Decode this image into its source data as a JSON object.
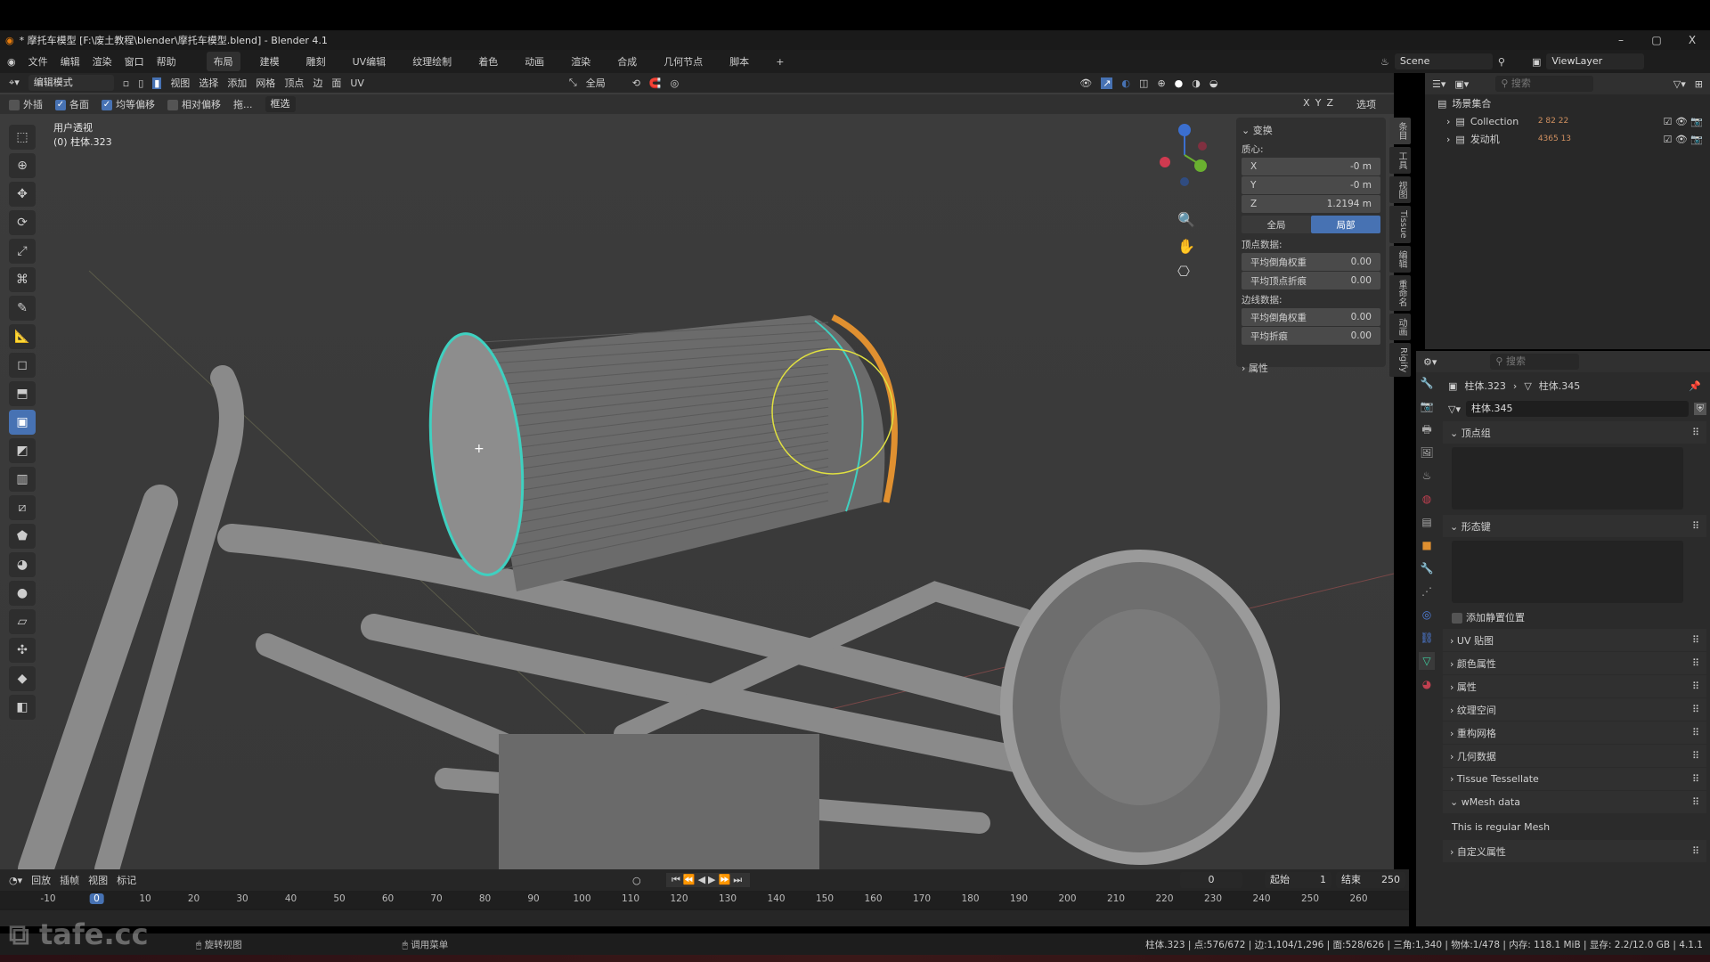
{
  "window": {
    "title": "* 摩托车模型 [F:\\废土教程\\blender\\摩托车模型.blend] - Blender 4.1",
    "minimize": "–",
    "maximize": "▢",
    "close": "X"
  },
  "menu": [
    "文件",
    "编辑",
    "渲染",
    "窗口",
    "帮助"
  ],
  "workspaces": [
    "布局",
    "建模",
    "雕刻",
    "UV编辑",
    "纹理绘制",
    "着色",
    "动画",
    "渲染",
    "合成",
    "几何节点",
    "脚本",
    "+"
  ],
  "scene": {
    "scene_label": "Scene",
    "viewlayer_label": "ViewLayer"
  },
  "viewport_header": {
    "mode": "编辑模式",
    "menus": [
      "视图",
      "选择",
      "添加",
      "网格",
      "顶点",
      "边",
      "面",
      "UV"
    ],
    "orientation": "全局",
    "options": "选项",
    "axes": [
      "X",
      "Y",
      "Z"
    ]
  },
  "tool_settings": {
    "extrude": "外插",
    "each_face": "各面",
    "even_offset": "均等偏移",
    "relative_offset": "相对偏移",
    "drag": "拖...",
    "select_mode": "框选",
    "checks": {
      "extrude": false,
      "each_face": true,
      "even_offset": true,
      "relative_offset": false
    }
  },
  "viewport_info": {
    "view": "用户透视",
    "object": "(0) 柱体.323"
  },
  "npanel": {
    "header": "变换",
    "median": "质心:",
    "x": {
      "label": "X",
      "value": "-0 m"
    },
    "y": {
      "label": "Y",
      "value": "-0 m"
    },
    "z": {
      "label": "Z",
      "value": "1.2194 m"
    },
    "global": "全局",
    "local": "局部",
    "vertex_data": "顶点数据:",
    "v_bevel": {
      "label": "平均倒角权重",
      "value": "0.00"
    },
    "v_crease": {
      "label": "平均顶点折痕",
      "value": "0.00"
    },
    "edge_data": "边线数据:",
    "e_bevel": {
      "label": "平均倒角权重",
      "value": "0.00"
    },
    "e_crease": {
      "label": "平均折痕",
      "value": "0.00"
    },
    "attributes": "属性"
  },
  "side_tabs": [
    "条目",
    "工具",
    "视图",
    "Tissue",
    "编辑",
    "重命名",
    "动画",
    "Rigify"
  ],
  "outliner": {
    "search_placeholder": "搜索",
    "root": "场景集合",
    "items": [
      {
        "name": "Collection",
        "counts": "2 82 22"
      },
      {
        "name": "发动机",
        "counts": "4365 13"
      }
    ]
  },
  "properties": {
    "search_placeholder": "搜索",
    "breadcrumb_object": "柱体.323",
    "breadcrumb_mesh": "柱体.345",
    "mesh_name": "柱体.345",
    "vertex_groups": "顶点组",
    "shape_keys": "形态键",
    "add_rest_position": "添加静置位置",
    "panels": [
      "UV 贴图",
      "颜色属性",
      "属性",
      "纹理空间",
      "重构网格",
      "几何数据",
      "Tissue Tessellate"
    ],
    "wmesh": "wMesh data",
    "wmesh_text": "This is regular Mesh",
    "custom_props": "自定义属性"
  },
  "timeline": {
    "menus": [
      "回放",
      "插帧",
      "视图",
      "标记"
    ],
    "current_frame": "0",
    "start_label": "起始",
    "start": "1",
    "end_label": "结束",
    "end": "250",
    "ticks": [
      "-10",
      "0",
      "10",
      "20",
      "30",
      "40",
      "50",
      "60",
      "70",
      "80",
      "90",
      "100",
      "110",
      "120",
      "130",
      "140",
      "150",
      "160",
      "170",
      "180",
      "190",
      "200",
      "210",
      "220",
      "230",
      "240",
      "250",
      "260"
    ]
  },
  "statusbar": {
    "rotate": "旋转视图",
    "menu": "调用菜单",
    "stats": "柱体.323 | 点:576/672 | 边:1,104/1,296 | 面:528/626 | 三角:1,340 | 物体:1/478 | 内存: 118.1 MiB | 显存: 2.2/12.0 GB | 4.1.1"
  },
  "watermark": "tafe.cc",
  "colors": {
    "accent": "#4772b3",
    "selection": "#3fd0c0",
    "active_edge": "#e09030"
  }
}
